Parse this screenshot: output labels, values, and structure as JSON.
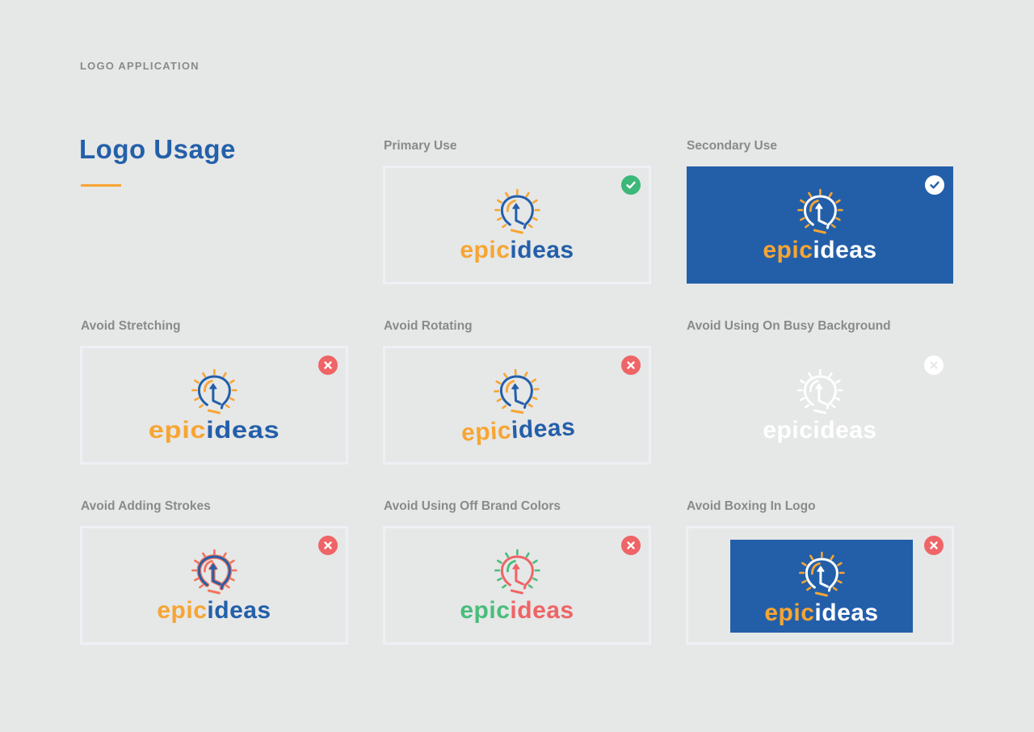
{
  "header": {
    "section_label": "LOGO APPLICATION",
    "title": "Logo Usage"
  },
  "colors": {
    "brand_blue": "#235fa9",
    "brand_orange": "#f7a532",
    "background": "#e6e7e7",
    "ok_green": "#3cb878",
    "bad_red": "#ef6466",
    "label_gray": "#8a8a8a",
    "off_green": "#49bd7b",
    "off_red": "#ef6466",
    "stroke_coral": "#f2745d"
  },
  "logo": {
    "word_part1": "epic",
    "word_part2": "ideas"
  },
  "tiles": [
    {
      "label": "Primary Use",
      "status": "correct",
      "status_icon": "check-icon"
    },
    {
      "label": "Secondary Use",
      "status": "correct",
      "status_icon": "check-icon"
    },
    {
      "label": "Avoid Stretching",
      "status": "incorrect",
      "status_icon": "x-icon"
    },
    {
      "label": "Avoid Rotating",
      "status": "incorrect",
      "status_icon": "x-icon"
    },
    {
      "label": "Avoid Using On Busy Background",
      "status": "incorrect",
      "status_icon": "x-icon"
    },
    {
      "label": "Avoid Adding Strokes",
      "status": "incorrect",
      "status_icon": "x-icon"
    },
    {
      "label": "Avoid Using Off Brand Colors",
      "status": "incorrect",
      "status_icon": "x-icon"
    },
    {
      "label": "Avoid Boxing In Logo",
      "status": "incorrect",
      "status_icon": "x-icon"
    }
  ]
}
